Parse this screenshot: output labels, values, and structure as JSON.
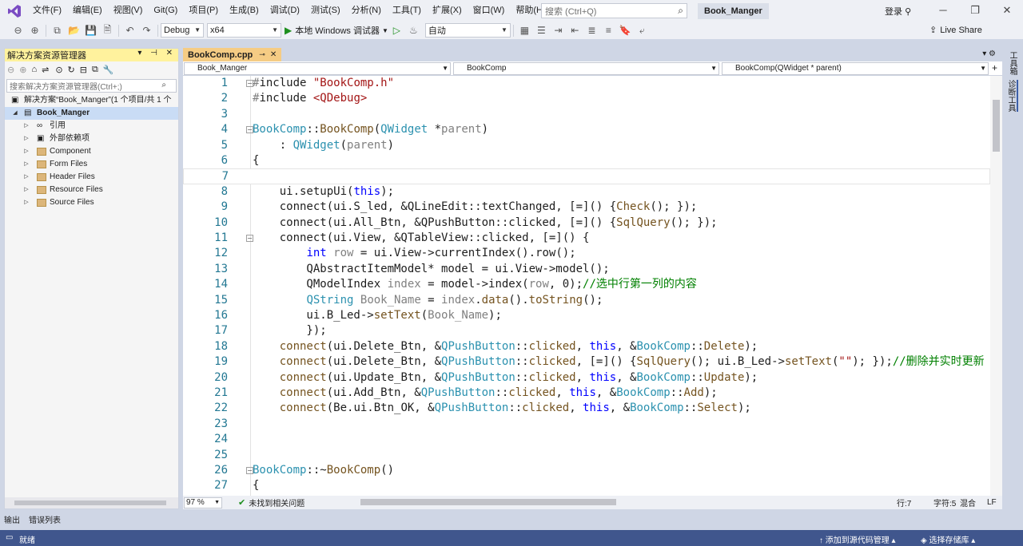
{
  "menu": {
    "items": [
      "文件(F)",
      "编辑(E)",
      "视图(V)",
      "Git(G)",
      "项目(P)",
      "生成(B)",
      "调试(D)",
      "测试(S)",
      "分析(N)",
      "工具(T)",
      "扩展(X)",
      "窗口(W)",
      "帮助(H)"
    ],
    "search_placeholder": "搜索 (Ctrl+Q)",
    "solution_title": "Book_Manger",
    "login": "登录"
  },
  "toolbar": {
    "config": "Debug",
    "platform": "x64",
    "run_label": "本地 Windows 调试器",
    "auto": "自动",
    "live_share": "Live Share"
  },
  "solution_explorer": {
    "title": "解决方案资源管理器",
    "search_placeholder": "搜索解决方案资源管理器(Ctrl+;)",
    "solution_row": "解决方案“Book_Manger”(1 个项目/共 1 个",
    "project": "Book_Manger",
    "items": [
      "引用",
      "外部依赖项",
      "Component",
      "Form Files",
      "Header Files",
      "Resource Files",
      "Source Files"
    ]
  },
  "editor": {
    "tab_label": "BookComp.cpp",
    "nav_project": "Book_Manger",
    "nav_scope": "BookComp",
    "nav_member": "BookComp(QWidget * parent)"
  },
  "code_lines": [
    {
      "n": "1",
      "html": "<span class=\"p\">#</span>include <span class=\"s\">\"BookComp.h\"</span>"
    },
    {
      "n": "2",
      "html": "<span class=\"p\">#</span>include <span class=\"s\">&lt;QDebug&gt;</span>"
    },
    {
      "n": "3",
      "html": ""
    },
    {
      "n": "4",
      "html": "<span class=\"t\">BookComp</span>::<span class=\"m\">BookComp</span>(<span class=\"t\">QWidget</span> *<span class=\"p\">parent</span>)"
    },
    {
      "n": "5",
      "html": "    : <span class=\"t\">QWidget</span>(<span class=\"p\">parent</span>)"
    },
    {
      "n": "6",
      "html": "{"
    },
    {
      "n": "7",
      "html": ""
    },
    {
      "n": "8",
      "html": "    ui.setupUi(<span class=\"k\">this</span>);"
    },
    {
      "n": "9",
      "html": "    connect(ui.S_led, &amp;QLineEdit::textChanged, [=]() {<span class=\"m\">Check</span>(); });"
    },
    {
      "n": "10",
      "html": "    connect(ui.All_Btn, &amp;QPushButton::clicked, [=]() {<span class=\"m\">SqlQuery</span>(); });"
    },
    {
      "n": "11",
      "html": "    connect(ui.View, &amp;QTableView::clicked, [=]() {"
    },
    {
      "n": "12",
      "html": "        <span class=\"k\">int</span> <span class=\"p\">row</span> = ui.View-&gt;currentIndex().row();"
    },
    {
      "n": "13",
      "html": "        QAbstractItemModel* model = ui.View-&gt;model();"
    },
    {
      "n": "14",
      "html": "        QModelIndex <span class=\"p\">index</span> = model-&gt;index(<span class=\"p\">row</span>, 0);<span class=\"c\">//选中行第一列的内容</span>"
    },
    {
      "n": "15",
      "html": "        <span class=\"t\">QString</span> <span class=\"p\">Book_Name</span> = <span class=\"p\">index</span>.<span class=\"m\">data</span>().<span class=\"m\">toString</span>();"
    },
    {
      "n": "16",
      "html": "        ui.B_Led-&gt;<span class=\"m\">setText</span>(<span class=\"p\">Book_Name</span>);"
    },
    {
      "n": "17",
      "html": "        });"
    },
    {
      "n": "18",
      "html": "    <span class=\"m\">connect</span>(ui.Delete_Btn, &amp;<span class=\"t\">QPushButton</span>::<span class=\"m\">clicked</span>, <span class=\"k\">this</span>, &amp;<span class=\"t\">BookComp</span>::<span class=\"m\">Delete</span>);"
    },
    {
      "n": "19",
      "html": "    <span class=\"m\">connect</span>(ui.Delete_Btn, &amp;<span class=\"t\">QPushButton</span>::<span class=\"m\">clicked</span>, [=]() {<span class=\"m\">SqlQuery</span>(); ui.B_Led-&gt;<span class=\"m\">setText</span>(<span class=\"s\">\"\"</span>); });<span class=\"c\">//删除并实时更新</span>"
    },
    {
      "n": "20",
      "html": "    <span class=\"m\">connect</span>(ui.Update_Btn, &amp;<span class=\"t\">QPushButton</span>::<span class=\"m\">clicked</span>, <span class=\"k\">this</span>, &amp;<span class=\"t\">BookComp</span>::<span class=\"m\">Update</span>);"
    },
    {
      "n": "21",
      "html": "    <span class=\"m\">connect</span>(ui.Add_Btn, &amp;<span class=\"t\">QPushButton</span>::<span class=\"m\">clicked</span>, <span class=\"k\">this</span>, &amp;<span class=\"t\">BookComp</span>::<span class=\"m\">Add</span>);"
    },
    {
      "n": "22",
      "html": "    <span class=\"m\">connect</span>(Be.ui.Btn_OK, &amp;<span class=\"t\">QPushButton</span>::<span class=\"m\">clicked</span>, <span class=\"k\">this</span>, &amp;<span class=\"t\">BookComp</span>::<span class=\"m\">Select</span>);"
    },
    {
      "n": "23",
      "html": ""
    },
    {
      "n": "24",
      "html": ""
    },
    {
      "n": "25",
      "html": ""
    },
    {
      "n": "26",
      "html": "<span class=\"t\">BookComp</span>::~<span class=\"m\">BookComp</span>()"
    },
    {
      "n": "27",
      "html": "{"
    }
  ],
  "editor_status": {
    "zoom": "97 %",
    "issues": "未找到相关问题",
    "line": "行:7",
    "col": "字符:5",
    "mixed": "混合",
    "eol": "LF"
  },
  "right_rail": [
    "工具箱",
    "诊断工具"
  ],
  "bottom_tabs": [
    "输出",
    "错误列表"
  ],
  "statusbar": {
    "ready": "就绪",
    "add_source": "添加到源代码管理",
    "select_repo": "选择存储库"
  }
}
